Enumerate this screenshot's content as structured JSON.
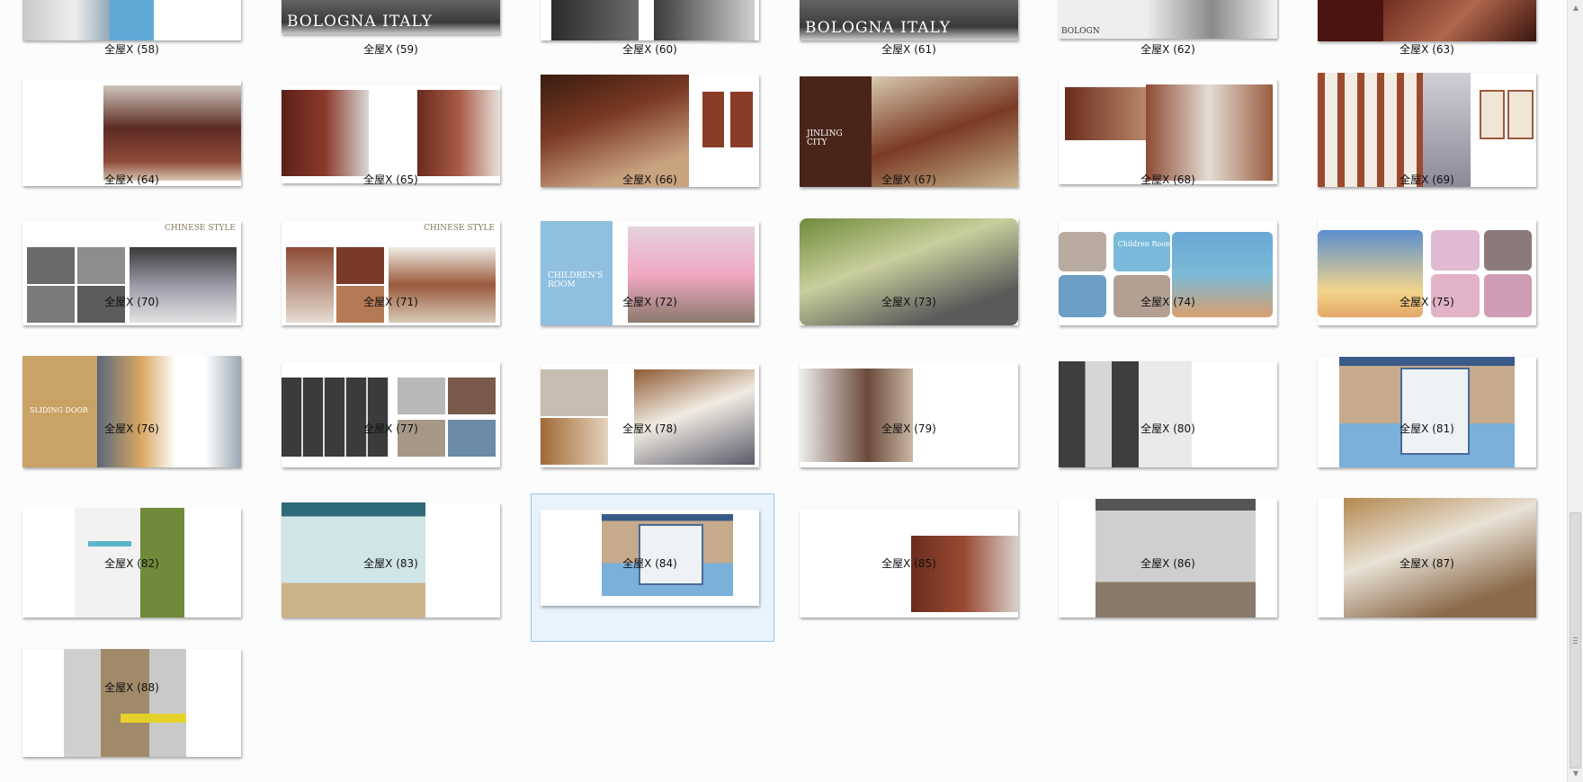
{
  "window": {
    "title": ""
  },
  "thumbnails": [
    {
      "label": "全屋X (58)",
      "style": "bathroom"
    },
    {
      "label": "全屋X (59)",
      "style": "bologna",
      "text": "BOLOGNA ITALY"
    },
    {
      "label": "全屋X (60)",
      "style": "dark-kitchen"
    },
    {
      "label": "全屋X (61)",
      "style": "bologna",
      "text": "BOLOGNA ITALY"
    },
    {
      "label": "全屋X (62)",
      "style": "kitchen",
      "text": "BOLOGN"
    },
    {
      "label": "全屋X (63)",
      "style": "maroon-living"
    },
    {
      "label": "全屋X (64)",
      "style": "study-right"
    },
    {
      "label": "全屋X (65)",
      "style": "wardrobe-pair"
    },
    {
      "label": "全屋X (66)",
      "style": "cellar"
    },
    {
      "label": "全屋X (67)",
      "style": "jinling",
      "text": "JINLING CITY"
    },
    {
      "label": "全屋X (68)",
      "style": "cabinet-pair"
    },
    {
      "label": "全屋X (69)",
      "style": "white-wardrobe"
    },
    {
      "label": "全屋X (70)",
      "style": "chinese-grid",
      "text": "CHINESE STYLE"
    },
    {
      "label": "全屋X (71)",
      "style": "chinese-grid2",
      "text": "CHINESE STYLE"
    },
    {
      "label": "全屋X (72)",
      "style": "children",
      "text": "CHILDREN'S ROOM"
    },
    {
      "label": "全屋X (73)",
      "style": "green-kids"
    },
    {
      "label": "全屋X (74)",
      "style": "kids-collage",
      "text": "Children Room"
    },
    {
      "label": "全屋X (75)",
      "style": "kids-collage2"
    },
    {
      "label": "全屋X (76)",
      "style": "sliding",
      "text": "SLIDING DOOR"
    },
    {
      "label": "全屋X (77)",
      "style": "sliding-collage"
    },
    {
      "label": "全屋X (78)",
      "style": "study-collage"
    },
    {
      "label": "全屋X (79)",
      "style": "bedroom-left"
    },
    {
      "label": "全屋X (80)",
      "style": "grey-wardrobe"
    },
    {
      "label": "全屋X (81)",
      "style": "blue-bedroom"
    },
    {
      "label": "全屋X (82)",
      "style": "green-wardrobe"
    },
    {
      "label": "全屋X (83)",
      "style": "teal-bedroom"
    },
    {
      "label": "全屋X (84)",
      "style": "blue-bedroom-center"
    },
    {
      "label": "全屋X (85)",
      "style": "brown-right"
    },
    {
      "label": "全屋X (86)",
      "style": "grey-room"
    },
    {
      "label": "全屋X (87)",
      "style": "beige-living"
    },
    {
      "label": "全屋X (88)",
      "style": "yellow-wardrobe"
    }
  ],
  "selected_label": "全屋X (84)",
  "colors": {
    "selection_border": "#99c3ee",
    "selection_fill": "#e9f3fd",
    "background": "#fcfcfc"
  },
  "icons": {
    "scroll_up": "▲",
    "scroll_down": "▼"
  }
}
